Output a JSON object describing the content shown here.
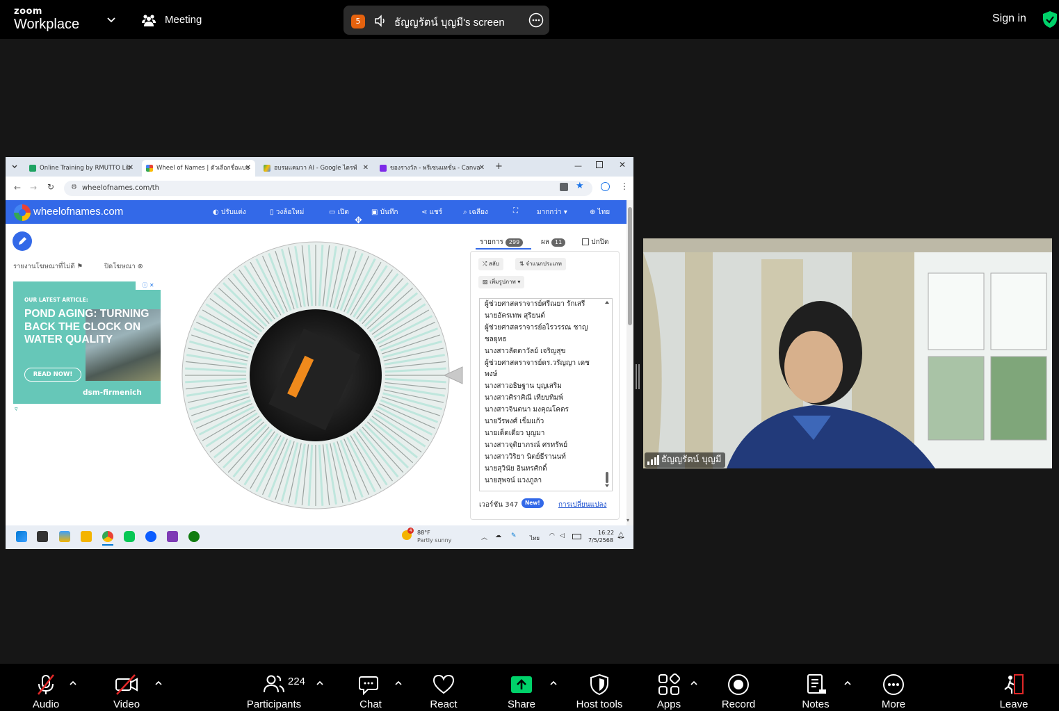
{
  "zoom": {
    "logo_small": "zoom",
    "logo_big": "Workplace",
    "meeting_label": "Meeting",
    "share_badge": "5",
    "share_title": "ธัญญรัตน์ บุญมี's screen",
    "sign_in": "Sign in",
    "accent_color": "#00d26a"
  },
  "browser": {
    "tabs": [
      {
        "label": "Online Training by RMUTTO Lib",
        "favicon_color": "#1ea362"
      },
      {
        "label": "Wheel of Names | ตัวเลือกชื่อแบบ",
        "favicon_color": "#ea4335"
      },
      {
        "label": "อบรมแคมวา AI - Google ไดรฟ์",
        "favicon_color": "#fbbc04"
      },
      {
        "label": "ของรางวัล - พรีเซนแทชั่น - Canva",
        "favicon_color": "#7d2ae8"
      }
    ],
    "url": "wheelofnames.com/th"
  },
  "wheel_site": {
    "name": "wheelofnames.com",
    "nav": [
      {
        "label": "ปรับแต่ง",
        "icon": "palette-icon"
      },
      {
        "label": "วงล้อใหม่",
        "icon": "file-icon"
      },
      {
        "label": "เปิด",
        "icon": "folder-icon"
      },
      {
        "label": "บันทึก",
        "icon": "save-icon"
      },
      {
        "label": "แชร์",
        "icon": "share-icon"
      },
      {
        "label": "เฉลียง",
        "icon": "search-icon"
      },
      {
        "label": "",
        "icon": "fullscreen-icon"
      },
      {
        "label": "มากกว่า",
        "icon": "chevron-down-icon"
      },
      {
        "label": "ไทย",
        "icon": "globe-icon"
      }
    ],
    "report_ad": "รายงานโฆษณาที่ไม่ดี",
    "close_ad": "ปิดโฆษณา",
    "ad": {
      "kicker": "OUR LATEST ARTICLE:",
      "headline": "POND AGING: TURNING BACK THE CLOCK ON WATER QUALITY",
      "button": "READ NOW!",
      "brand": "dsm-firmenich"
    },
    "panel": {
      "tab_entries": "รายการ",
      "entries_count": "299",
      "tab_results": "ผล",
      "results_count": "11",
      "hide_label": "ปกปิด",
      "shuffle": "สลับ",
      "sort": "จำแนกประเภท",
      "add_image": "เพิ่มรูปภาพ",
      "entries": [
        "ผู้ช่วยศาสตราจารย์ศรีณยา รักเสรี",
        "นายอัครเทพ สุริยนต์",
        "ผู้ช่วยศาสตราจารย์อไรวรรณ ชาญ",
        "ชลยุทธ",
        "นางสาวลัดดาวัลย์ เจริญสุข",
        "ผู้ช่วยศาสตราจารย์ดร.วรัญญา เดช",
        "พงษ์",
        "นางสาวอธิษฐาน บุญเสริม",
        "นางสาวศิราศิณี เทียบทิมพ์",
        "นางสาวจินตนา มงคุณโคตร",
        "นายวีรพงศ์ เข็มแก้ว",
        "นายเด็ดเดี่ยว บุญมา",
        "นางสาวจุติยาภรณ์ ศรทรัพย์",
        "นางสาววิริยา นิตย์ธีรานนท์",
        "นายสุวินัย อินทรศักดิ์",
        "นายสุพจน์ แวงภูลา"
      ],
      "version": "เวอร์ชัน 347",
      "new_badge": "New!",
      "changes_link": "การเปลี่ยนแปลง"
    }
  },
  "taskbar": {
    "weather_temp": "88°F",
    "weather_desc": "Partly sunny",
    "weather_badge": "4",
    "lang": "ไทย",
    "time": "16:22",
    "date": "7/5/2568"
  },
  "video": {
    "participant_name": "ธัญญรัตน์ บุญมี"
  },
  "toolbar": {
    "audio": "Audio",
    "video": "Video",
    "participants": "Participants",
    "participants_count": "224",
    "chat": "Chat",
    "react": "React",
    "share": "Share",
    "host_tools": "Host tools",
    "apps": "Apps",
    "record": "Record",
    "notes": "Notes",
    "more": "More",
    "leave": "Leave"
  }
}
